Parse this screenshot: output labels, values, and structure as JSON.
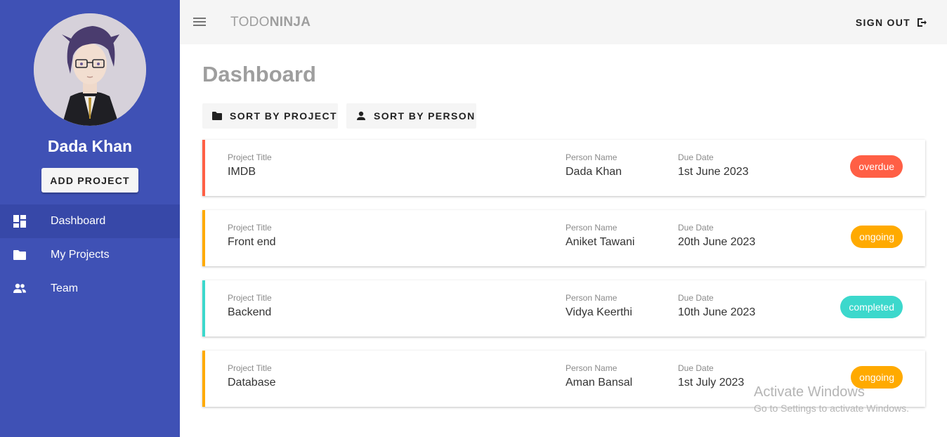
{
  "sidebar": {
    "user_name": "Dada Khan",
    "add_project_label": "ADD PROJECT",
    "items": [
      {
        "label": "Dashboard",
        "icon": "dashboard-icon",
        "active": true
      },
      {
        "label": "My Projects",
        "icon": "folder-icon",
        "active": false
      },
      {
        "label": "Team",
        "icon": "people-icon",
        "active": false
      }
    ],
    "color": "#3f51b5"
  },
  "header": {
    "brand_part1": "TODO",
    "brand_part2": "NINJA",
    "signout_label": "SIGN OUT"
  },
  "main": {
    "title": "Dashboard",
    "sort_project_label": "SORT BY PROJECT",
    "sort_person_label": "SORT BY PERSON",
    "labels": {
      "project_title": "Project Title",
      "person_name": "Person Name",
      "due_date": "Due Date"
    },
    "projects": [
      {
        "title": "IMDB",
        "person": "Dada Khan",
        "due": "1st June 2023",
        "status": "overdue"
      },
      {
        "title": "Front end",
        "person": "Aniket Tawani",
        "due": "20th June 2023",
        "status": "ongoing"
      },
      {
        "title": "Backend",
        "person": "Vidya Keerthi",
        "due": "10th June 2023",
        "status": "completed"
      },
      {
        "title": "Database",
        "person": "Aman Bansal",
        "due": "1st July 2023",
        "status": "ongoing"
      }
    ]
  },
  "status_colors": {
    "overdue": "#ff5f45",
    "ongoing": "#ffaa00",
    "completed": "#3cd8cc"
  },
  "watermark": {
    "line1": "Activate Windows",
    "line2": "Go to Settings to activate Windows."
  }
}
